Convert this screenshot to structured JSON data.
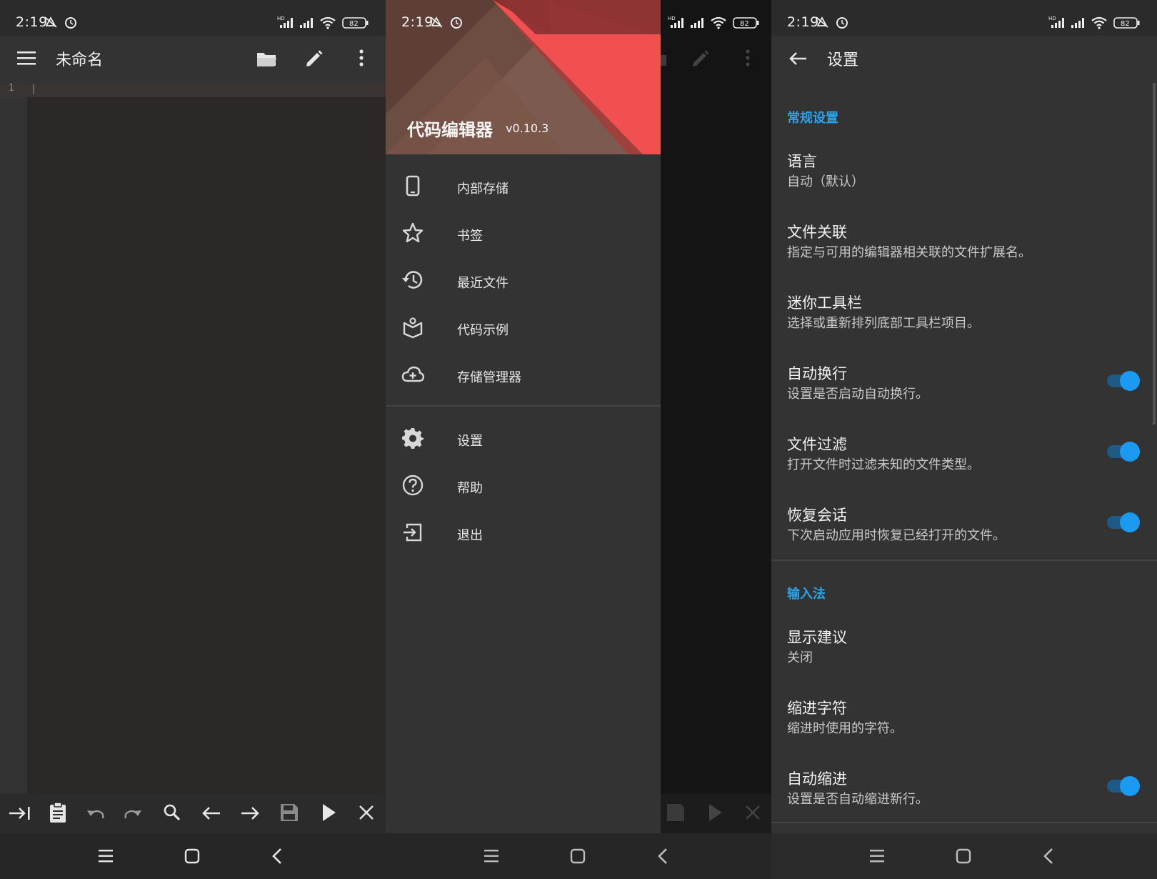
{
  "status_bar": {
    "time": "2:19",
    "battery": "82",
    "network_label": "HD"
  },
  "editor_screen": {
    "title": "未命名",
    "line_number": "1"
  },
  "drawer": {
    "title": "代码编辑器",
    "version": "v0.10.3",
    "items": [
      {
        "label": "内部存储",
        "icon": "phone-icon"
      },
      {
        "label": "书签",
        "icon": "star-icon"
      },
      {
        "label": "最近文件",
        "icon": "history-icon"
      },
      {
        "label": "代码示例",
        "icon": "code-sample-icon"
      },
      {
        "label": "存储管理器",
        "icon": "cloud-add-icon"
      },
      {
        "label": "设置",
        "icon": "gear-icon"
      },
      {
        "label": "帮助",
        "icon": "help-icon"
      },
      {
        "label": "退出",
        "icon": "exit-icon"
      }
    ]
  },
  "settings": {
    "title": "设置",
    "sections": [
      {
        "header": "常规设置",
        "items": [
          {
            "title": "语言",
            "subtitle": "自动（默认）"
          },
          {
            "title": "文件关联",
            "subtitle": "指定与可用的编辑器相关联的文件扩展名。"
          },
          {
            "title": "迷你工具栏",
            "subtitle": "选择或重新排列底部工具栏项目。"
          },
          {
            "title": "自动换行",
            "subtitle": "设置是否启动自动换行。",
            "toggle": true
          },
          {
            "title": "文件过滤",
            "subtitle": "打开文件时过滤未知的文件类型。",
            "toggle": true
          },
          {
            "title": "恢复会话",
            "subtitle": "下次启动应用时恢复已经打开的文件。",
            "toggle": true
          }
        ]
      },
      {
        "header": "输入法",
        "items": [
          {
            "title": "显示建议",
            "subtitle": "关闭"
          },
          {
            "title": "缩进字符",
            "subtitle": "缩进时使用的字符。"
          },
          {
            "title": "自动缩进",
            "subtitle": "设置是否自动缩进新行。",
            "toggle": true
          }
        ]
      }
    ]
  },
  "colors": {
    "accent": "#2aa3e8",
    "toggle_on": "#1a9af0",
    "header_red": "#f25050",
    "header_brown": "#6d4c42"
  }
}
